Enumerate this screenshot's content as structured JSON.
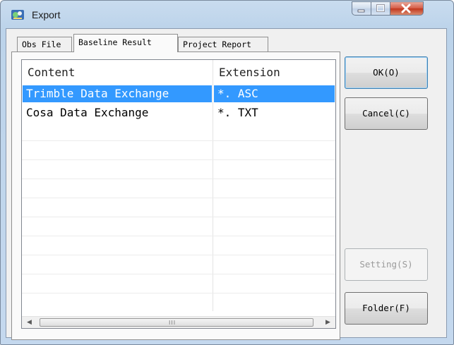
{
  "window": {
    "title": "Export"
  },
  "tabs": [
    {
      "label": "Obs File"
    },
    {
      "label": "Baseline Result"
    },
    {
      "label": "Project Report"
    }
  ],
  "list": {
    "columns": [
      "Content",
      "Extension"
    ],
    "rows": [
      {
        "content": "Trimble Data Exchange",
        "extension": "*. ASC",
        "selected": true
      },
      {
        "content": "Cosa Data Exchange",
        "extension": "*. TXT",
        "selected": false
      }
    ],
    "scroll_grip": "III"
  },
  "buttons": {
    "ok": "OK(O)",
    "cancel": "Cancel(C)",
    "setting": "Setting(S)",
    "folder": "Folder(F)"
  },
  "colors": {
    "selection": "#3399ff",
    "titlebar": "#bcd3ea",
    "close": "#c2361d"
  }
}
